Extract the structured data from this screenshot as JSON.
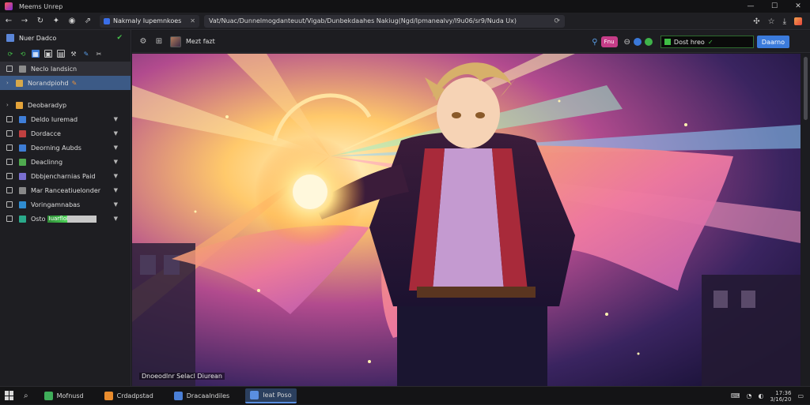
{
  "window": {
    "title": "Meems Unrep",
    "controls": [
      "—",
      "☐",
      "✕"
    ]
  },
  "toolbar": {
    "tab_title": "Nakmaly Iupemnkoes",
    "tab_close": "✕",
    "url": "Vat/Nuac/Dunnelmogdanteuut/Vigab/Dunbekdaahes Nakiug(Ngd/Ipmanealvy/I9u06/sr9/Nuda Ux)",
    "new_tab": "⟳"
  },
  "subbar": {
    "file_label": "Mezt fazt",
    "pill_label": "Fnu",
    "field_value": "Dost hreo",
    "button_label": "Daarno"
  },
  "sidebar": {
    "header": "Nuer Dadco",
    "items": [
      {
        "label": "Neclo landsicn",
        "state": "selected",
        "control": "checkbox",
        "icon_color": "#8c8c8c"
      },
      {
        "label": "Norandpiohd",
        "state": "active",
        "control": "arrow",
        "icon_color": "#d7a84a"
      },
      {
        "label": "Deobaradyp",
        "state": "normal",
        "control": "arrow",
        "icon_color": "#e3a33a"
      },
      {
        "label": "Deldo Iuremad",
        "state": "normal",
        "control": "checkbox",
        "icon_color": "#3f7ed8"
      },
      {
        "label": "Dordacce",
        "state": "normal",
        "control": "checkbox",
        "icon_color": "#c04040"
      },
      {
        "label": "Deorning Aubds",
        "state": "normal",
        "control": "checkbox",
        "icon_color": "#3e7dd5"
      },
      {
        "label": "Deaclinng",
        "state": "normal",
        "control": "checkbox",
        "icon_color": "#4faa4f"
      },
      {
        "label": "Dbbjencharnias Paid",
        "state": "normal",
        "control": "checkbox",
        "icon_color": "#7a6fd0"
      },
      {
        "label": "Mar Ranceatiuelonder",
        "state": "normal",
        "control": "checkbox",
        "icon_color": "#888888"
      },
      {
        "label": "Voringamnabas",
        "state": "normal",
        "control": "checkbox",
        "icon_color": "#2f8cd0"
      },
      {
        "label": "Osto",
        "state": "normal",
        "control": "checkbox",
        "icon_color": "#2aa98a",
        "bar_text": "Iuarfloi"
      }
    ]
  },
  "viewer": {
    "caption": "Dnoeodlnr Selacl Diurean"
  },
  "taskbar": {
    "tasks": [
      {
        "label": "Mofnusd",
        "color": "#3fae5a",
        "active": false
      },
      {
        "label": "Crdadpstad",
        "color": "#e98c2e",
        "active": false
      },
      {
        "label": "Dracaalndiles",
        "color": "#4a7fd6",
        "active": false
      },
      {
        "label": "Ieat Poso",
        "color": "#5a8fe0",
        "active": true
      }
    ],
    "time": "17:36",
    "date": "3/16/20"
  }
}
